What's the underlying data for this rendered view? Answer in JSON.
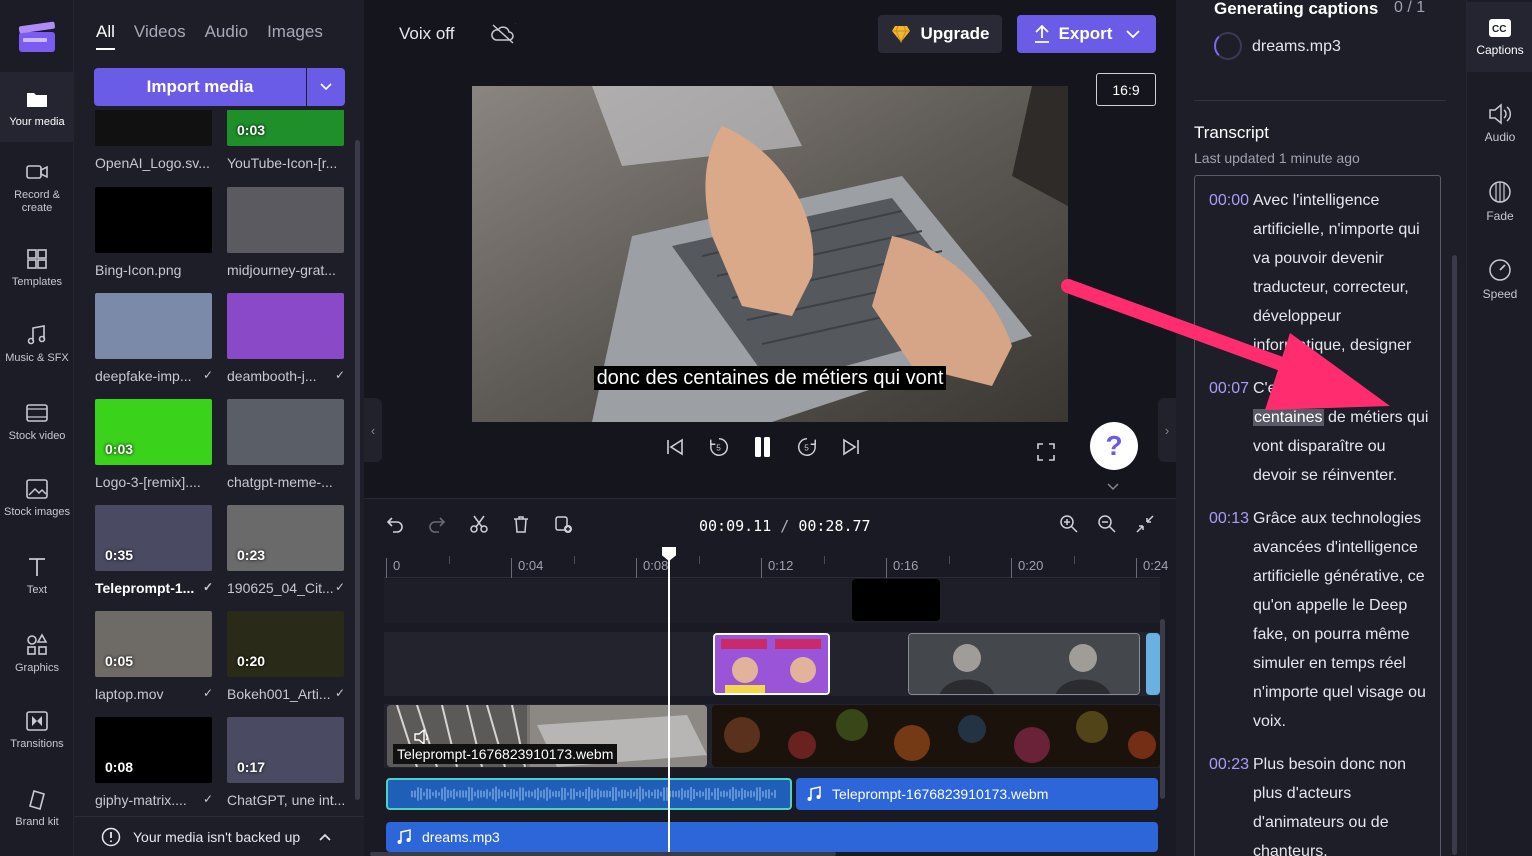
{
  "left_rail": {
    "items": [
      {
        "label": "Your media"
      },
      {
        "label": "Record & create"
      },
      {
        "label": "Templates"
      },
      {
        "label": "Music & SFX"
      },
      {
        "label": "Stock video"
      },
      {
        "label": "Stock images"
      },
      {
        "label": "Text"
      },
      {
        "label": "Graphics"
      },
      {
        "label": "Transitions"
      },
      {
        "label": "Brand kit"
      }
    ]
  },
  "media": {
    "tabs": [
      "All",
      "Videos",
      "Audio",
      "Images"
    ],
    "import_label": "Import media",
    "items": [
      {
        "name": "OpenAI_Logo.sv...",
        "duration": "",
        "color": "#111111"
      },
      {
        "name": "YouTube-Icon-[r...",
        "duration": "0:03",
        "color": "#1f8f2a"
      },
      {
        "name": "Bing-Icon.png",
        "duration": "",
        "color": "#000000"
      },
      {
        "name": "midjourney-grat...",
        "duration": "",
        "color": "#5a5a60"
      },
      {
        "name": "deepfake-imp...",
        "duration": "",
        "color": "#7a8aa8"
      },
      {
        "name": "deambooth-j...",
        "duration": "",
        "color": "#8a4ac8"
      },
      {
        "name": "Logo-3-[remix]....",
        "duration": "0:03",
        "color": "#3ad21a"
      },
      {
        "name": "chatgpt-meme-...",
        "duration": "",
        "color": "#5a5e66"
      },
      {
        "name": "Teleprompt-1...",
        "duration": "0:35",
        "color": "#4a4a62"
      },
      {
        "name": "190625_04_Cit...",
        "duration": "0:23",
        "color": "#6a6a6a"
      },
      {
        "name": "laptop.mov",
        "duration": "0:05",
        "color": "#6e6a66"
      },
      {
        "name": "Bokeh001_Arti...",
        "duration": "0:20",
        "color": "#2a2a18"
      },
      {
        "name": "giphy-matrix....",
        "duration": "0:08",
        "color": "#000000"
      },
      {
        "name": "ChatGPT, une int...",
        "duration": "0:17",
        "color": "#4a4a62"
      }
    ],
    "backup_text": "Your media isn't backed up"
  },
  "topbar": {
    "project_title": "Voix off",
    "upgrade_label": "Upgrade",
    "export_label": "Export"
  },
  "preview": {
    "aspect_ratio": "16:9",
    "subtitle": "donc des centaines de métiers qui vont",
    "help": "?"
  },
  "timeline": {
    "current_time": "00:09.11",
    "total_time": "00:28.77",
    "ruler_ticks": [
      "0",
      "0:04",
      "0:08",
      "0:12",
      "0:16",
      "0:20",
      "0:24"
    ],
    "clips": {
      "video_label": "Teleprompt-1676823910173.webm",
      "audio1_label": "Teleprompt-1676823910173.webm",
      "audio2_label": "dreams.mp3"
    }
  },
  "captions": {
    "generating_title": "Generating captions",
    "count": "0 / 1",
    "file": "dreams.mp3",
    "transcript_title": "Transcript",
    "last_updated": "Last updated 1 minute ago",
    "segments": [
      {
        "time": "00:00",
        "text": "Avec l'intelligence artificielle, n'importe qui va pouvoir devenir traducteur, correcteur, développeur informatique, designer"
      },
      {
        "time": "00:07",
        "text_before": "C'est donc des ",
        "highlight": "centaines",
        "text_after": " de métiers qui vont disparaître ou devoir se réinventer."
      },
      {
        "time": "00:13",
        "text": "Grâce aux technologies avancées d'intelligence artificielle générative, ce qu'on appelle le Deep fake, on pourra même simuler en temps réel n'importe quel visage ou voix."
      },
      {
        "time": "00:23",
        "text": "Plus besoin donc non plus d'acteurs d'animateurs ou de chanteurs."
      }
    ]
  },
  "right_rail": {
    "items": [
      {
        "label": "Captions"
      },
      {
        "label": "Audio"
      },
      {
        "label": "Fade"
      },
      {
        "label": "Speed"
      }
    ]
  },
  "colors": {
    "accent": "#6b5ce7",
    "audio_clip": "#2c66d8",
    "annotation_arrow": "#ff2d6f"
  }
}
